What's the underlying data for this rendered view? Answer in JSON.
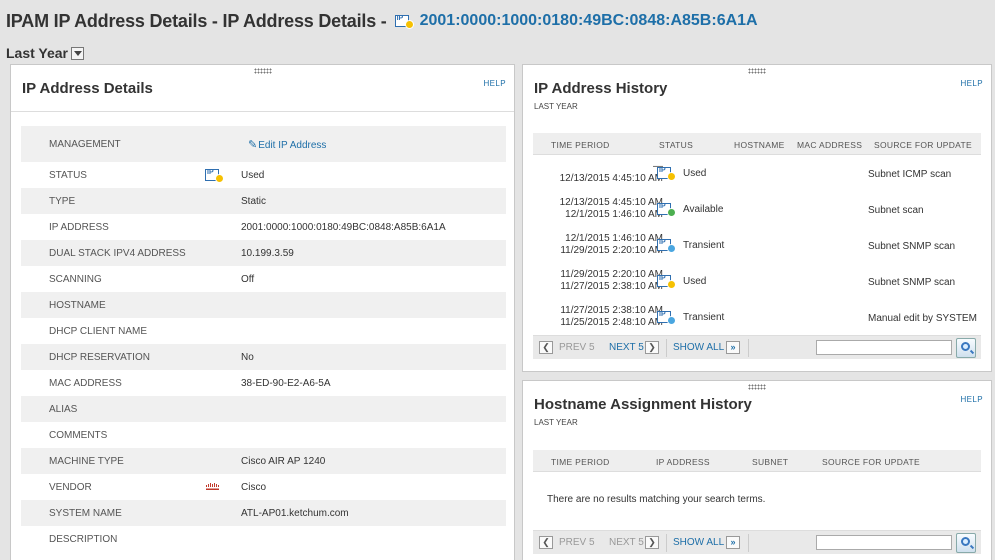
{
  "page": {
    "title": "IPAM IP Address Details - IP Address Details -",
    "ip": "2001:0000:1000:0180:49BC:0848:A85B:6A1A",
    "timeframe": "Last Year"
  },
  "colors": {
    "used": "#f6c102",
    "available": "#4caf50",
    "transient": "#4aa6e0",
    "link": "#1e6fa8"
  },
  "details": {
    "title": "IP Address Details",
    "help": "HELP",
    "edit_link": "Edit IP Address",
    "rows": [
      {
        "label": "MANAGEMENT",
        "value": ""
      },
      {
        "label": "STATUS",
        "value": "Used",
        "icon": "ip-used-icon"
      },
      {
        "label": "TYPE",
        "value": "Static"
      },
      {
        "label": "IP ADDRESS",
        "value": "2001:0000:1000:0180:49BC:0848:A85B:6A1A"
      },
      {
        "label": "DUAL STACK IPV4 ADDRESS",
        "value": "10.199.3.59"
      },
      {
        "label": "SCANNING",
        "value": "Off"
      },
      {
        "label": "HOSTNAME",
        "value": ""
      },
      {
        "label": "DHCP CLIENT NAME",
        "value": ""
      },
      {
        "label": "DHCP RESERVATION",
        "value": "No"
      },
      {
        "label": "MAC ADDRESS",
        "value": "38-ED-90-E2-A6-5A"
      },
      {
        "label": "ALIAS",
        "value": ""
      },
      {
        "label": "COMMENTS",
        "value": ""
      },
      {
        "label": "MACHINE TYPE",
        "value": "Cisco AIR AP 1240"
      },
      {
        "label": "VENDOR",
        "value": "Cisco",
        "icon": "cisco-logo-icon"
      },
      {
        "label": "SYSTEM NAME",
        "value": "ATL-AP01.ketchum.com"
      },
      {
        "label": "DESCRIPTION",
        "value": ""
      }
    ]
  },
  "history": {
    "title": "IP Address History",
    "subtitle": "LAST YEAR",
    "help": "HELP",
    "columns": [
      "TIME PERIOD",
      "STATUS",
      "HOSTNAME",
      "MAC ADDRESS",
      "SOURCE FOR UPDATE"
    ],
    "rows": [
      {
        "start": "—",
        "end": "12/13/2015 4:45:10 AM",
        "status": "Used",
        "state": "used",
        "source": "Subnet ICMP scan"
      },
      {
        "start": "12/13/2015 4:45:10 AM",
        "end": "12/1/2015 1:46:10 AM",
        "status": "Available",
        "state": "available",
        "source": "Subnet scan"
      },
      {
        "start": "12/1/2015 1:46:10 AM",
        "end": "11/29/2015 2:20:10 AM",
        "status": "Transient",
        "state": "transient",
        "source": "Subnet SNMP scan"
      },
      {
        "start": "11/29/2015 2:20:10 AM",
        "end": "11/27/2015 2:38:10 AM",
        "status": "Used",
        "state": "used",
        "source": "Subnet SNMP scan"
      },
      {
        "start": "11/27/2015 2:38:10 AM",
        "end": "11/25/2015 2:48:10 AM",
        "status": "Transient",
        "state": "transient",
        "source": "Manual edit by SYSTEM"
      }
    ],
    "pager": {
      "prev": "PREV 5",
      "next": "NEXT 5",
      "show_all": "SHOW ALL",
      "search_value": ""
    }
  },
  "hostnames": {
    "title": "Hostname Assignment History",
    "subtitle": "LAST YEAR",
    "help": "HELP",
    "columns": [
      "TIME PERIOD",
      "IP ADDRESS",
      "SUBNET",
      "SOURCE FOR UPDATE"
    ],
    "empty": "There are no results matching your search terms.",
    "pager": {
      "prev": "PREV 5",
      "next": "NEXT 5",
      "show_all": "SHOW ALL",
      "search_value": ""
    }
  }
}
